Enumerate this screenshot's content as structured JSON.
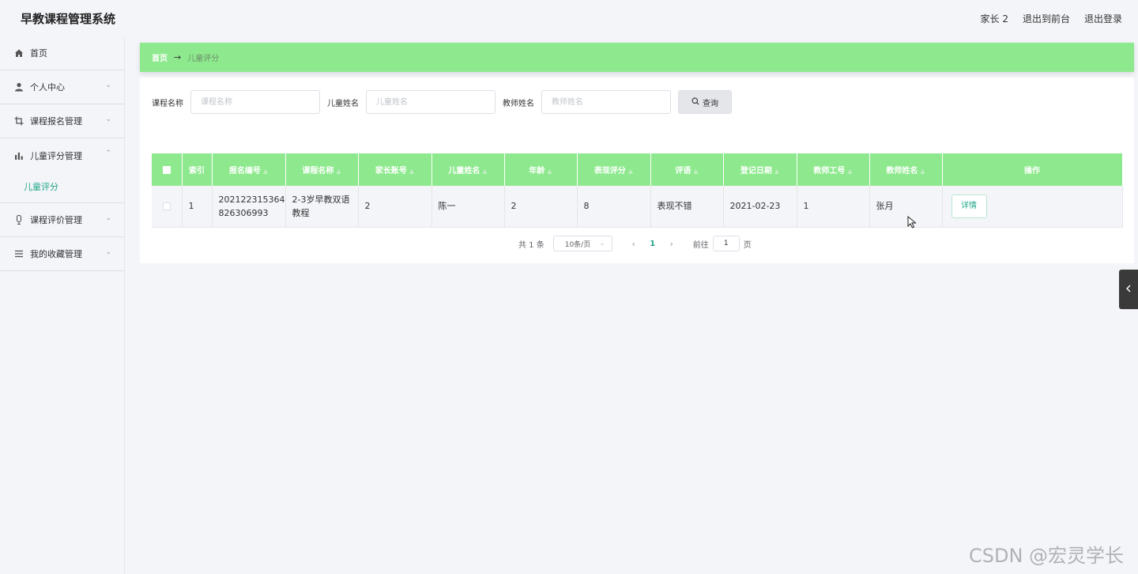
{
  "app": {
    "title": "早教课程管理系统"
  },
  "header": {
    "user": "家长 2",
    "to_front": "退出到前台",
    "logout": "退出登录"
  },
  "sidebar": {
    "items": [
      {
        "label": "首页",
        "icon": "home-icon"
      },
      {
        "label": "个人中心",
        "icon": "user-icon"
      },
      {
        "label": "课程报名管理",
        "icon": "crop-icon"
      },
      {
        "label": "儿童评分管理",
        "icon": "bar-chart-icon",
        "expanded": true,
        "sub": [
          "儿童评分"
        ]
      },
      {
        "label": "课程评价管理",
        "icon": "microphone-icon"
      },
      {
        "label": "我的收藏管理",
        "icon": "list-icon"
      }
    ]
  },
  "breadcrumb": {
    "home": "首页",
    "current": "儿童评分"
  },
  "search": {
    "course_label": "课程名称",
    "course_placeholder": "课程名称",
    "child_label": "儿童姓名",
    "child_placeholder": "儿童姓名",
    "teacher_label": "教师姓名",
    "teacher_placeholder": "教师姓名",
    "button": "查询"
  },
  "table": {
    "headers": [
      "索引",
      "报名编号",
      "课程名称",
      "家长账号",
      "儿童姓名",
      "年龄",
      "表现评分",
      "评语",
      "登记日期",
      "教师工号",
      "教师姓名",
      "操作"
    ],
    "rows": [
      {
        "index": "1",
        "reg_no_line1": "202122315364",
        "reg_no_line2": "826306993",
        "course_line1": "2-3岁早教双语",
        "course_line2": "教程",
        "parent": "2",
        "child": "陈一",
        "age": "2",
        "score": "8",
        "comment": "表现不错",
        "date": "2021-02-23",
        "teacher_id": "1",
        "teacher": "张月",
        "action": "详情"
      }
    ]
  },
  "pagination": {
    "total": "共 1 条",
    "page_size": "10条/页",
    "current": "1",
    "goto_label": "前往",
    "goto_value": "1",
    "page_unit": "页"
  },
  "watermark": "CSDN @宏灵学长",
  "colors": {
    "accent_green": "#8ee98e",
    "link_green": "#21a68a"
  }
}
